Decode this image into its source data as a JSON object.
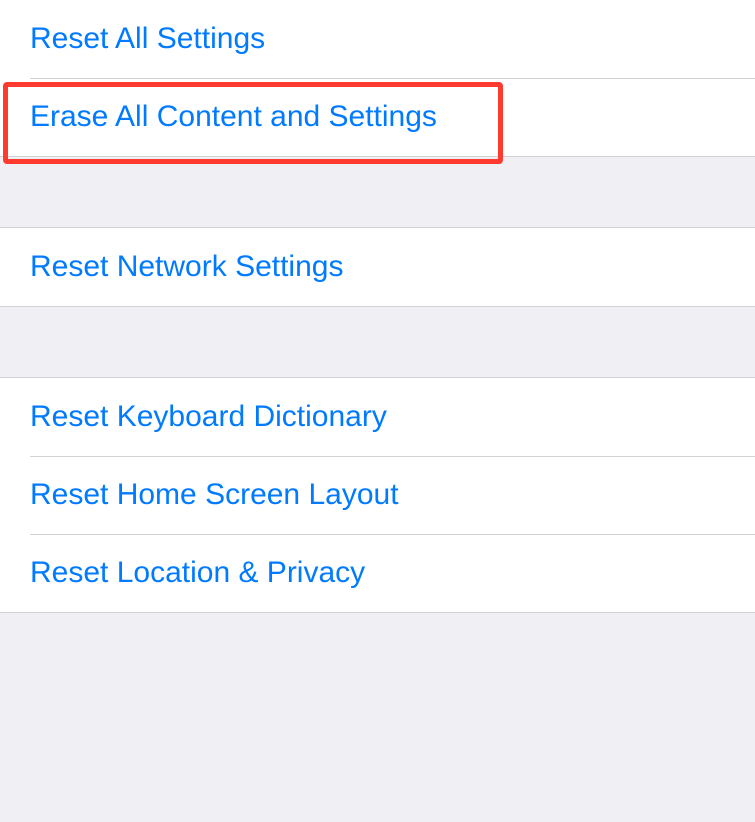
{
  "sections": {
    "group1": {
      "reset_all": "Reset All Settings",
      "erase_all": "Erase All Content and Settings"
    },
    "group2": {
      "reset_network": "Reset Network Settings"
    },
    "group3": {
      "reset_keyboard": "Reset Keyboard Dictionary",
      "reset_home": "Reset Home Screen Layout",
      "reset_location": "Reset Location & Privacy"
    }
  },
  "highlight": {
    "target": "erase-all-content-button"
  }
}
